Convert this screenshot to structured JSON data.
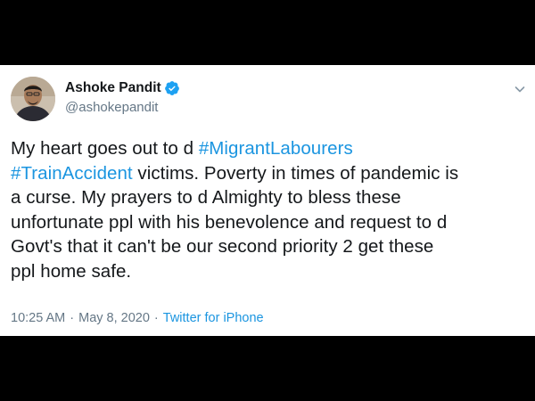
{
  "tweet": {
    "display_name": "Ashoke Pandit",
    "handle": "@ashokepandit",
    "text": {
      "line1_pre": "My heart goes out to d ",
      "hashtag1": "#MigrantLabourers",
      "hashtag2": "#TrainAccident",
      "line2_post": " victims. Poverty in times of pandemic is",
      "line3": "a curse. My prayers to d Almighty to bless these",
      "line4": "unfortunate ppl with his benevolence and request to d",
      "line5": "Govt's that it can't be our second priority 2 get these",
      "line6": "ppl home safe."
    },
    "time": "10:25 AM",
    "separator": "·",
    "date": "May 8, 2020",
    "source": "Twitter for iPhone",
    "verified": true
  },
  "colors": {
    "accent": "#1b95e0",
    "text": "#14171a",
    "muted": "#657786",
    "verified_badge": "#1da1f2"
  },
  "icons": {
    "verified": "verified-badge-icon",
    "caret": "chevron-down-icon"
  }
}
